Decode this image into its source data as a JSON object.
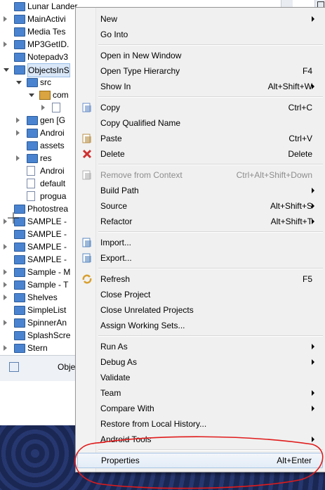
{
  "tree": [
    {
      "label": "Lunar Lander",
      "kind": "folder",
      "indent": 0,
      "twisty": "none",
      "sel": false
    },
    {
      "label": "MainActivi",
      "kind": "folder",
      "indent": 0,
      "twisty": "closed",
      "sel": false
    },
    {
      "label": "Media Tes",
      "kind": "folder",
      "indent": 0,
      "twisty": "none",
      "sel": false
    },
    {
      "label": "MP3GetID.",
      "kind": "folder",
      "indent": 0,
      "twisty": "closed",
      "sel": false
    },
    {
      "label": "Notepadv3",
      "kind": "folder",
      "indent": 0,
      "twisty": "none",
      "sel": false
    },
    {
      "label": "ObjectsInS",
      "kind": "folder",
      "indent": 0,
      "twisty": "open",
      "sel": true
    },
    {
      "label": "src",
      "kind": "folder",
      "indent": 1,
      "twisty": "open",
      "sel": false
    },
    {
      "label": "com",
      "kind": "pkg",
      "indent": 2,
      "twisty": "open",
      "sel": false
    },
    {
      "label": "",
      "kind": "file",
      "indent": 3,
      "twisty": "closed",
      "sel": false
    },
    {
      "label": "gen [G",
      "kind": "folder",
      "indent": 1,
      "twisty": "closed",
      "sel": false
    },
    {
      "label": "Androi",
      "kind": "folder",
      "indent": 1,
      "twisty": "closed",
      "sel": false
    },
    {
      "label": "assets",
      "kind": "folder",
      "indent": 1,
      "twisty": "none",
      "sel": false
    },
    {
      "label": "res",
      "kind": "folder",
      "indent": 1,
      "twisty": "closed",
      "sel": false
    },
    {
      "label": "Androi",
      "kind": "file",
      "indent": 1,
      "twisty": "none",
      "sel": false
    },
    {
      "label": "default",
      "kind": "file",
      "indent": 1,
      "twisty": "none",
      "sel": false
    },
    {
      "label": "progua",
      "kind": "file",
      "indent": 1,
      "twisty": "none",
      "sel": false
    },
    {
      "label": "Photostrea",
      "kind": "folder",
      "indent": 0,
      "twisty": "none",
      "sel": false
    },
    {
      "label": "SAMPLE -",
      "kind": "folder",
      "indent": 0,
      "twisty": "closed",
      "sel": false
    },
    {
      "label": "SAMPLE -",
      "kind": "folder",
      "indent": 0,
      "twisty": "none",
      "sel": false
    },
    {
      "label": "SAMPLE -",
      "kind": "folder",
      "indent": 0,
      "twisty": "closed",
      "sel": false
    },
    {
      "label": "SAMPLE -",
      "kind": "folder",
      "indent": 0,
      "twisty": "none",
      "sel": false
    },
    {
      "label": "Sample - M",
      "kind": "folder",
      "indent": 0,
      "twisty": "closed",
      "sel": false
    },
    {
      "label": "Sample - T",
      "kind": "folder",
      "indent": 0,
      "twisty": "closed",
      "sel": false
    },
    {
      "label": "Shelves",
      "kind": "folder",
      "indent": 0,
      "twisty": "closed",
      "sel": false
    },
    {
      "label": "SimpleList",
      "kind": "folder",
      "indent": 0,
      "twisty": "none",
      "sel": false
    },
    {
      "label": "SpinnerAn",
      "kind": "folder",
      "indent": 0,
      "twisty": "closed",
      "sel": false
    },
    {
      "label": "SplashScre",
      "kind": "folder",
      "indent": 0,
      "twisty": "none",
      "sel": false
    },
    {
      "label": "Stern",
      "kind": "folder",
      "indent": 0,
      "twisty": "closed",
      "sel": false
    }
  ],
  "bottom_tab": {
    "label": "Obje"
  },
  "menu": {
    "items": [
      {
        "type": "item",
        "label": "New",
        "shortcut": "",
        "submenu": true,
        "icon": "",
        "disabled": false
      },
      {
        "type": "item",
        "label": "Go Into",
        "shortcut": "",
        "submenu": false,
        "icon": "",
        "disabled": false
      },
      {
        "type": "sep"
      },
      {
        "type": "item",
        "label": "Open in New Window",
        "shortcut": "",
        "submenu": false,
        "icon": "",
        "disabled": false
      },
      {
        "type": "item",
        "label": "Open Type Hierarchy",
        "shortcut": "F4",
        "submenu": false,
        "icon": "",
        "disabled": false
      },
      {
        "type": "item",
        "label": "Show In",
        "shortcut": "Alt+Shift+W",
        "submenu": true,
        "icon": "",
        "disabled": false
      },
      {
        "type": "sep"
      },
      {
        "type": "item",
        "label": "Copy",
        "shortcut": "Ctrl+C",
        "submenu": false,
        "icon": "copy-icon",
        "disabled": false
      },
      {
        "type": "item",
        "label": "Copy Qualified Name",
        "shortcut": "",
        "submenu": false,
        "icon": "",
        "disabled": false
      },
      {
        "type": "item",
        "label": "Paste",
        "shortcut": "Ctrl+V",
        "submenu": false,
        "icon": "paste-icon",
        "disabled": false
      },
      {
        "type": "item",
        "label": "Delete",
        "shortcut": "Delete",
        "submenu": false,
        "icon": "delete-icon",
        "disabled": false
      },
      {
        "type": "sep"
      },
      {
        "type": "item",
        "label": "Remove from Context",
        "shortcut": "Ctrl+Alt+Shift+Down",
        "submenu": false,
        "icon": "remove-context-icon",
        "disabled": true
      },
      {
        "type": "item",
        "label": "Build Path",
        "shortcut": "",
        "submenu": true,
        "icon": "",
        "disabled": false
      },
      {
        "type": "item",
        "label": "Source",
        "shortcut": "Alt+Shift+S",
        "submenu": true,
        "icon": "",
        "disabled": false
      },
      {
        "type": "item",
        "label": "Refactor",
        "shortcut": "Alt+Shift+T",
        "submenu": true,
        "icon": "",
        "disabled": false
      },
      {
        "type": "sep"
      },
      {
        "type": "item",
        "label": "Import...",
        "shortcut": "",
        "submenu": false,
        "icon": "import-icon",
        "disabled": false
      },
      {
        "type": "item",
        "label": "Export...",
        "shortcut": "",
        "submenu": false,
        "icon": "export-icon",
        "disabled": false
      },
      {
        "type": "sep"
      },
      {
        "type": "item",
        "label": "Refresh",
        "shortcut": "F5",
        "submenu": false,
        "icon": "refresh-icon",
        "disabled": false
      },
      {
        "type": "item",
        "label": "Close Project",
        "shortcut": "",
        "submenu": false,
        "icon": "",
        "disabled": false
      },
      {
        "type": "item",
        "label": "Close Unrelated Projects",
        "shortcut": "",
        "submenu": false,
        "icon": "",
        "disabled": false
      },
      {
        "type": "item",
        "label": "Assign Working Sets...",
        "shortcut": "",
        "submenu": false,
        "icon": "",
        "disabled": false
      },
      {
        "type": "sep"
      },
      {
        "type": "item",
        "label": "Run As",
        "shortcut": "",
        "submenu": true,
        "icon": "",
        "disabled": false
      },
      {
        "type": "item",
        "label": "Debug As",
        "shortcut": "",
        "submenu": true,
        "icon": "",
        "disabled": false
      },
      {
        "type": "item",
        "label": "Validate",
        "shortcut": "",
        "submenu": false,
        "icon": "",
        "disabled": false
      },
      {
        "type": "item",
        "label": "Team",
        "shortcut": "",
        "submenu": true,
        "icon": "",
        "disabled": false
      },
      {
        "type": "item",
        "label": "Compare With",
        "shortcut": "",
        "submenu": true,
        "icon": "",
        "disabled": false
      },
      {
        "type": "item",
        "label": "Restore from Local History...",
        "shortcut": "",
        "submenu": false,
        "icon": "",
        "disabled": false
      },
      {
        "type": "item",
        "label": "Android Tools",
        "shortcut": "",
        "submenu": true,
        "icon": "",
        "disabled": false
      },
      {
        "type": "sep"
      },
      {
        "type": "item",
        "label": "Properties",
        "shortcut": "Alt+Enter",
        "submenu": false,
        "icon": "",
        "disabled": false,
        "highlight": true
      }
    ]
  },
  "colors": {
    "annotation": "#e01b1b",
    "selection": "#d9e7f8",
    "menu_bg": "#f0f0f0"
  }
}
